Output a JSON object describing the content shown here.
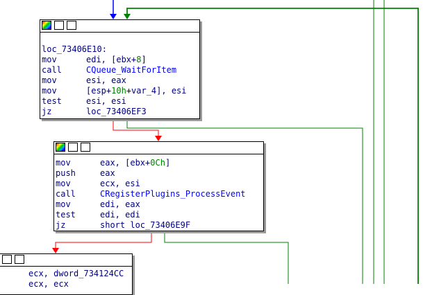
{
  "colors": {
    "edge_true": "#008000",
    "edge_false": "#ff0000",
    "edge_normal": "#0000ff",
    "text": "#000080",
    "number": "#008000",
    "name": "#0000ff"
  },
  "node1": {
    "label": "loc_73406E10:",
    "lines": [
      {
        "mnemonic": "mov",
        "op_a": "edi, [ebx+",
        "num": "8",
        "op_b": "]"
      },
      {
        "mnemonic": "call",
        "name": "CQueue_WaitForItem"
      },
      {
        "mnemonic": "mov",
        "op_a": "esi, eax"
      },
      {
        "mnemonic": "mov",
        "op_a": "[esp+",
        "num": "10h",
        "op_b": "+var_4], esi"
      },
      {
        "mnemonic": "test",
        "op_a": "esi, esi"
      },
      {
        "mnemonic": "jz",
        "op_a": "loc_73406EF3"
      }
    ]
  },
  "node2": {
    "lines": [
      {
        "mnemonic": "mov",
        "op_a": "eax, [ebx+",
        "num": "0Ch",
        "op_b": "]"
      },
      {
        "mnemonic": "push",
        "op_a": "eax"
      },
      {
        "mnemonic": "mov",
        "op_a": "ecx, esi"
      },
      {
        "mnemonic": "call",
        "name": "CRegisterPlugins_ProcessEvent"
      },
      {
        "mnemonic": "mov",
        "op_a": "edi, eax"
      },
      {
        "mnemonic": "test",
        "op_a": "edi, edi"
      },
      {
        "mnemonic": "jz",
        "op_a": "short loc_73406E9F"
      }
    ]
  },
  "node3": {
    "lines": [
      {
        "op_a": "ecx, dword_734124CC"
      },
      {
        "op_a": "ecx, ecx"
      }
    ]
  }
}
